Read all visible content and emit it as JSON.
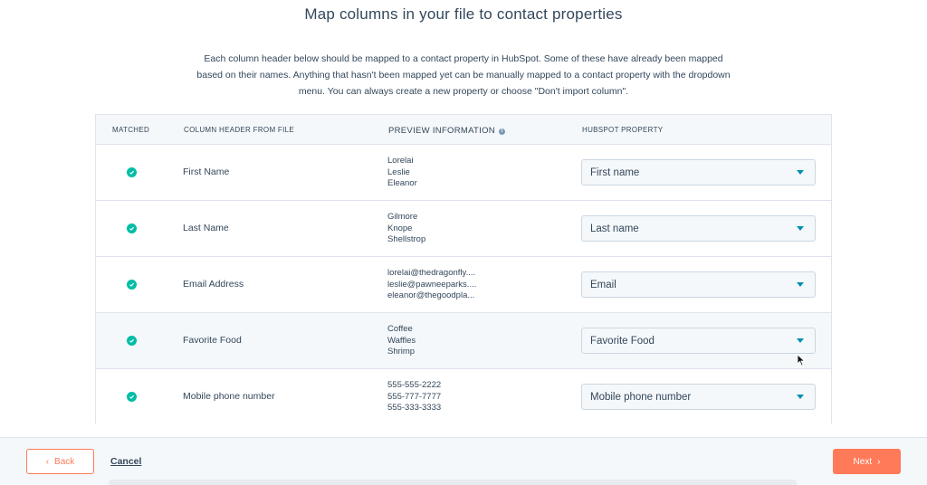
{
  "page": {
    "title": "Map columns in your file to contact properties",
    "description": "Each column header below should be mapped to a contact property in HubSpot. Some of these have already been mapped based on their names. Anything that hasn't been mapped yet can be manually mapped to a contact property with the dropdown menu. You can always create a new property or choose \"Don't import column\"."
  },
  "table": {
    "headers": {
      "matched": "MATCHED",
      "column": "COLUMN HEADER FROM FILE",
      "preview": "PREVIEW INFORMATION",
      "property": "HUBSPOT PROPERTY"
    },
    "rows": [
      {
        "column": "First Name",
        "preview": [
          "Lorelai",
          "Leslie",
          "Eleanor"
        ],
        "property": "First name"
      },
      {
        "column": "Last Name",
        "preview": [
          "Gilmore",
          "Knope",
          "Shellstrop"
        ],
        "property": "Last name"
      },
      {
        "column": "Email Address",
        "preview": [
          "lorelai@thedragonfly....",
          "leslie@pawneeparks....",
          "eleanor@thegoodpla..."
        ],
        "property": "Email"
      },
      {
        "column": "Favorite Food",
        "preview": [
          "Coffee",
          "Waffles",
          "Shrimp"
        ],
        "property": "Favorite Food"
      },
      {
        "column": "Mobile phone number",
        "preview": [
          "555-555-2222",
          "555-777-7777",
          "555-333-3333"
        ],
        "property": "Mobile phone number"
      }
    ]
  },
  "footer": {
    "back_label": "Back",
    "cancel_label": "Cancel",
    "next_label": "Next"
  },
  "colors": {
    "accent": "#ff7a59",
    "check": "#00bda5",
    "caret": "#0091ae"
  }
}
